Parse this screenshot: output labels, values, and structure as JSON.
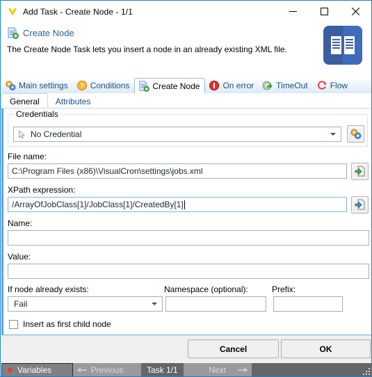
{
  "window": {
    "title": "Add Task - Create Node - 1/1",
    "logo_icon": "visualcron-v-logo-icon",
    "minimize_label": "—",
    "maximize_label": "□",
    "close_label": "✕"
  },
  "header": {
    "icon": "create-node-icon",
    "title": "Create Node",
    "description": "The Create Node Task lets you insert a node in an already existing XML file.",
    "badge_icon": "book-icon"
  },
  "tabs": [
    {
      "label": "Main settings",
      "icon": "gears-icon",
      "active": false
    },
    {
      "label": "Conditions",
      "icon": "question-mark-icon",
      "active": false
    },
    {
      "label": "Create Node",
      "icon": "create-node-icon",
      "active": true
    },
    {
      "label": "On error",
      "icon": "error-circle-icon",
      "active": false
    },
    {
      "label": "TimeOut",
      "icon": "timeout-arrow-icon",
      "active": false
    },
    {
      "label": "Flow",
      "icon": "flow-loop-icon",
      "active": false
    }
  ],
  "subtabs": [
    {
      "label": "General",
      "active": true
    },
    {
      "label": "Attributes",
      "active": false
    }
  ],
  "form": {
    "credentials_group_label": "Credentials",
    "credential_value": "No Credential",
    "credential_icon": "cursor-arrow-icon",
    "credential_settings_icon": "gears-icon",
    "file_name_label": "File name:",
    "file_name_value": "C:\\Program Files (x86)\\VisualCron\\settings\\jobs.xml",
    "file_browse_icon": "file-browse-icon",
    "xpath_label": "XPath expression:",
    "xpath_value": "/ArrayOfJobClass[1]/JobClass[1]/CreatedBy[1]",
    "xpath_browse_icon": "xml-browse-icon",
    "name_label": "Name:",
    "name_value": "",
    "value_label": "Value:",
    "value_value": "",
    "if_exists_label": "If node already exists:",
    "if_exists_value": "Fail",
    "namespace_label": "Namespace (optional):",
    "namespace_value": "",
    "prefix_label": "Prefix:",
    "prefix_value": "",
    "insert_first_child_label": "Insert as first child node",
    "insert_first_child_checked": false
  },
  "footer": {
    "cancel_label": "Cancel",
    "ok_label": "OK"
  },
  "statusbar": {
    "variables_label": "Variables",
    "previous_label": "Previous",
    "task_label": "Task 1/1",
    "next_label": "Next"
  },
  "colors": {
    "window_border": "#1883d7",
    "accent_blue": "#2a6099",
    "badge_blue": "#3a5fa0",
    "statusbar_bg": "#666666",
    "variables_dot": "#e8412c"
  }
}
